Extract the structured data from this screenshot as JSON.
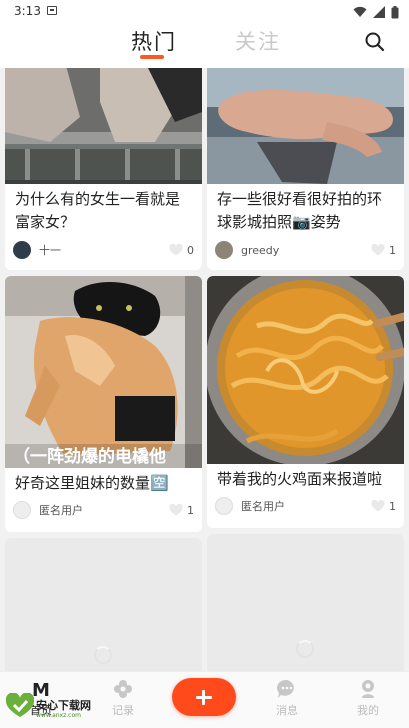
{
  "status_bar": {
    "time": "3:13"
  },
  "header": {
    "tabs": [
      {
        "label": "热门",
        "active": true
      },
      {
        "label": "关注",
        "active": false
      }
    ]
  },
  "feed": {
    "posts": [
      {
        "title": "为什么有的女生一看就是富家女？",
        "user": "十一",
        "likes": "0"
      },
      {
        "title": "存一些很好看很好拍的环球影城拍照📷姿势",
        "user": "greedy",
        "likes": "1"
      },
      {
        "title": "好奇这里姐妹的数量🈳",
        "user": "匿名用户",
        "likes": "1",
        "image_caption": "（一阵劲爆的电橇他"
      },
      {
        "title": "带着我的火鸡面来报道啦",
        "user": "匿名用户",
        "likes": "1"
      }
    ]
  },
  "bottom_nav": {
    "items": [
      {
        "label": "首页",
        "icon": "m-logo-icon"
      },
      {
        "label": "记录",
        "icon": "flower-icon"
      },
      {
        "label": "",
        "icon": "plus-icon"
      },
      {
        "label": "消息",
        "icon": "chat-icon"
      },
      {
        "label": "我的",
        "icon": "person-icon"
      }
    ]
  },
  "watermark": {
    "text": "安心下载网",
    "sub": "www.anxz.com"
  },
  "colors": {
    "accent": "#ff5722",
    "fab": "#ff4a1c",
    "inactive": "#c9c9c9"
  }
}
